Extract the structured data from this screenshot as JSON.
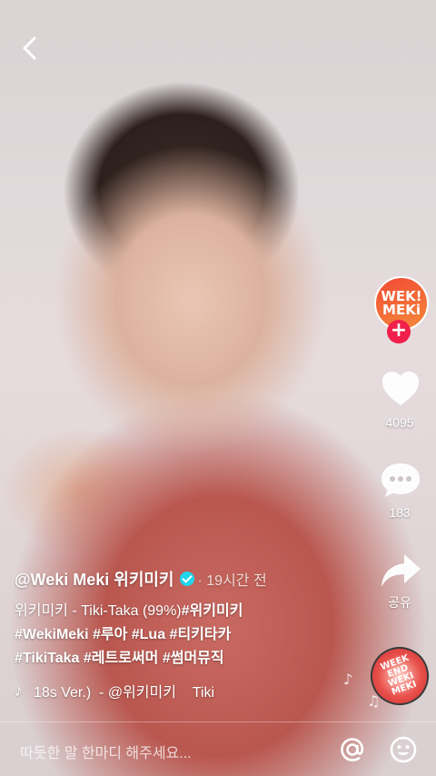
{
  "profile": {
    "avatar_text_top": "WEK!",
    "avatar_text_bottom": "MEKi",
    "follow_symbol": "+"
  },
  "actions": {
    "likes": "4095",
    "comments": "183",
    "share_label": "공유"
  },
  "caption": {
    "username": "@Weki Meki 위키미키",
    "time_ago": "· 19시간 전",
    "line1_prefix": "위키미키 - Tiki-Taka (99%)",
    "line1_tag": "#위키미키",
    "line2": "#WekiMeki #루아 #Lua #티키타카",
    "line3": "#TikiTaka #레트로써머 #썸머뮤직"
  },
  "music": {
    "text": "18s Ver.)  - @위키미키    Tiki",
    "disc_text": "WEEK\nEND\nWEKI\nMEKI"
  },
  "bottom": {
    "comment_placeholder": "따듯한 말 한마디 해주세요..."
  },
  "colors": {
    "follow": "#f0204a",
    "verified": "#20d5ec",
    "avatar": "#f24a35"
  }
}
